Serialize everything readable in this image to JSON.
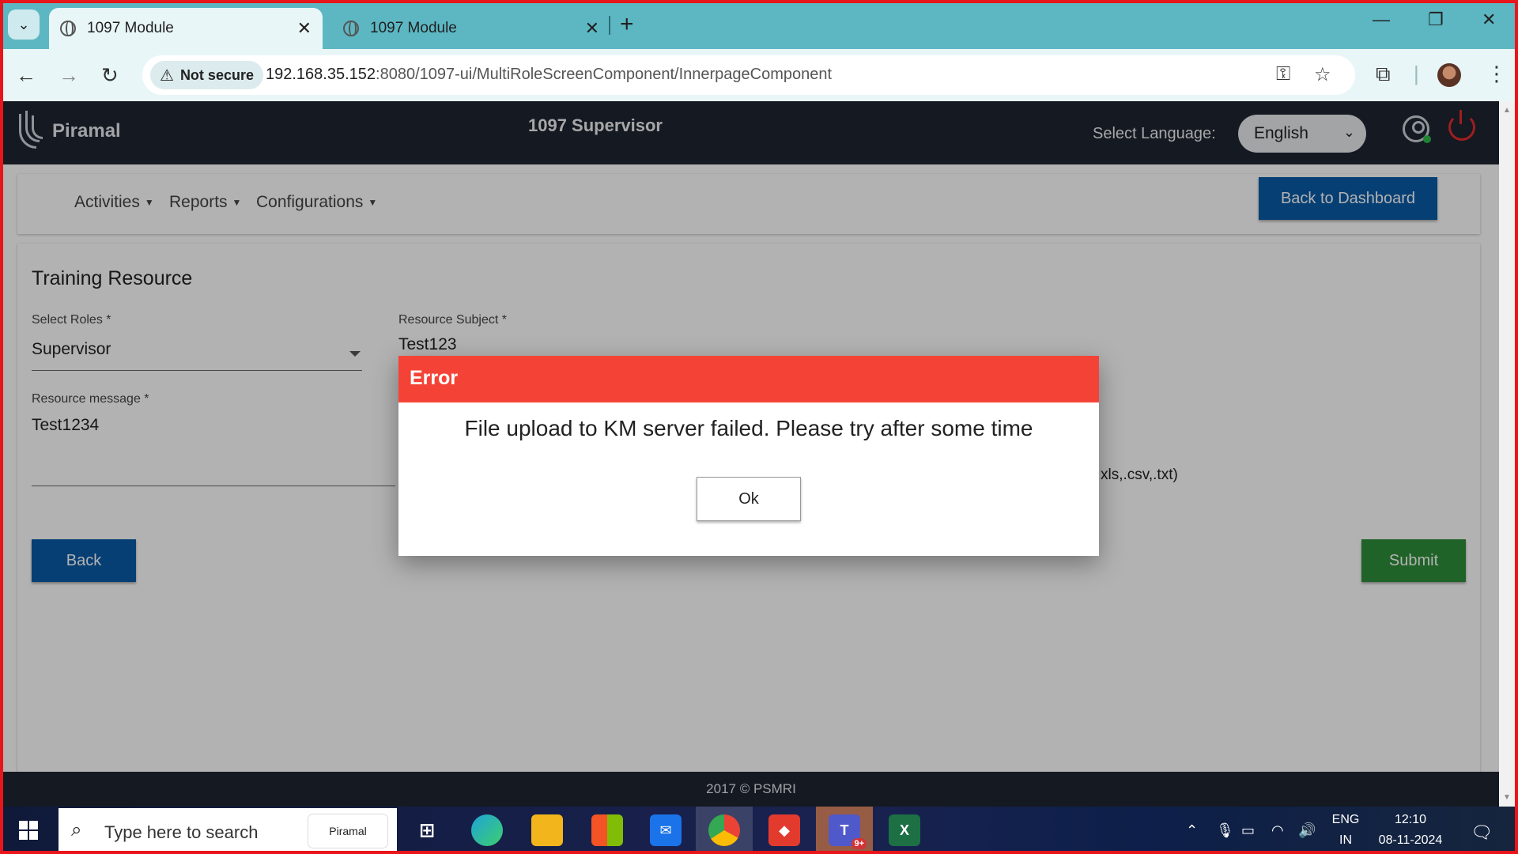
{
  "browser": {
    "tabs": [
      {
        "title": "1097 Module",
        "active": true
      },
      {
        "title": "1097 Module",
        "active": false
      }
    ],
    "security_label": "Not secure",
    "url_host": "192.168.35.152",
    "url_rest": ":8080/1097-ui/MultiRoleScreenComponent/InnerpageComponent"
  },
  "app": {
    "logo_text": "Piramal",
    "title": "1097 Supervisor",
    "language_label": "Select Language:",
    "language_value": "English",
    "menu": [
      "Activities",
      "Reports",
      "Configurations"
    ],
    "back_to_dashboard": "Back to Dashboard",
    "footer": "2017 © PSMRI"
  },
  "form": {
    "title": "Training Resource",
    "roles_label": "Select Roles *",
    "roles_value": "Supervisor",
    "subject_label": "Resource Subject *",
    "subject_value": "Test123",
    "message_label": "Resource message *",
    "message_value": "Test1234",
    "file_hint_partial": "xls,.csv,.txt)",
    "back_label": "Back",
    "submit_label": "Submit"
  },
  "dialog": {
    "title": "Error",
    "message": "File upload to KM server failed. Please try after some time",
    "ok_label": "Ok"
  },
  "taskbar": {
    "search_placeholder": "Type here to search",
    "search_widget": "Piramal",
    "teams_badge": "9+",
    "lang_top": "ENG",
    "lang_bottom": "IN",
    "time": "12:10",
    "date": "08-11-2024"
  },
  "colors": {
    "header_bg": "#1d2532",
    "primary_button": "#0a5ba6",
    "submit_button": "#2f8f3a",
    "error_header": "#f44336"
  }
}
